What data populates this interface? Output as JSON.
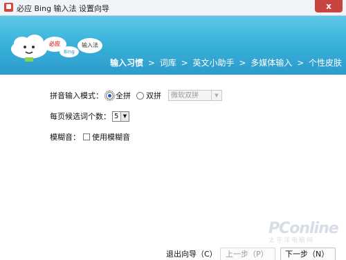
{
  "window": {
    "title": "必应 Bing 输入法 设置向导",
    "close_label": "x"
  },
  "banner": {
    "logo_bubble1": "必应",
    "logo_bubble2": "Bing",
    "logo_bubble3": "输入法",
    "steps": [
      {
        "label": "输入习惯",
        "current": true
      },
      {
        "label": "词库",
        "current": false
      },
      {
        "label": "英文小助手",
        "current": false
      },
      {
        "label": "多媒体输入",
        "current": false
      },
      {
        "label": "个性皮肤",
        "current": false
      }
    ],
    "step_separator": ">"
  },
  "settings": {
    "input_mode_label": "拼音输入模式：",
    "option_full": "全拼",
    "option_double": "双拼",
    "double_scheme_value": "微软双拼",
    "candidates_label": "每页候选词个数：",
    "candidates_value": "5",
    "fuzzy_label": "模糊音：",
    "fuzzy_checkbox_label": "使用模糊音"
  },
  "footer": {
    "exit_label": "退出向导（C）",
    "prev_label": "上一步（P）",
    "next_label": "下一步（N）"
  },
  "watermark": {
    "text": "PConline",
    "sub": "太平洋电脑网"
  },
  "colors": {
    "banner": "#3bb3dc",
    "close": "#c7453e"
  }
}
